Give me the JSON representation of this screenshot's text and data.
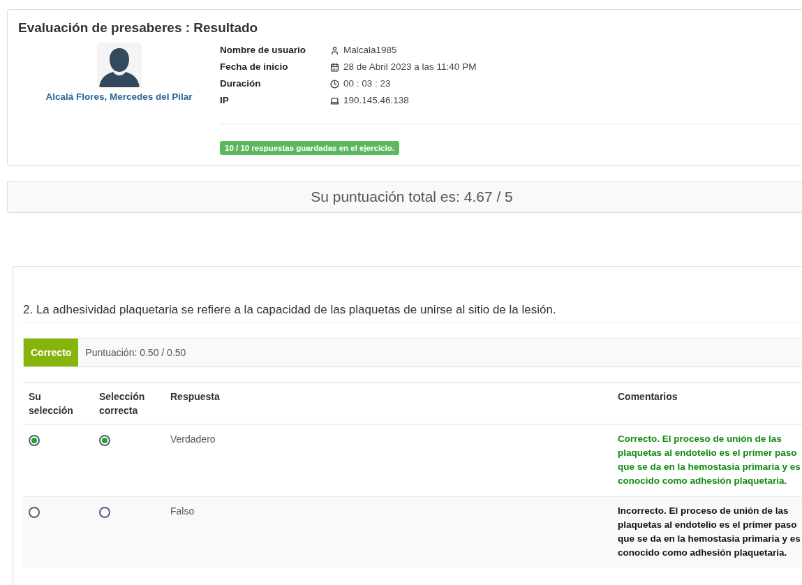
{
  "header": {
    "title": "Evaluación de presaberes : Resultado",
    "user_name": "Alcalá Flores, Mercedes del Pilar",
    "details": [
      {
        "label": "Nombre de usuario",
        "kind": "user",
        "value": "Malcala1985"
      },
      {
        "label": "Fecha de inicio",
        "kind": "calendar",
        "value": "28 de Abril 2023 a las 11:40 PM"
      },
      {
        "label": "Duración",
        "kind": "clock",
        "value": "00 : 03 : 23"
      },
      {
        "label": "IP",
        "kind": "computer",
        "value": "190.145.46.138"
      }
    ],
    "badge": "10 / 10 respuestas guardadas en el ejercicio."
  },
  "score": "Su puntuación total es: 4.67 / 5",
  "question": {
    "text": "2. La adhesividad plaquetaria se refiere a la capacidad de las plaquetas de unirse al sitio de la lesión.",
    "status": "Correcto",
    "status_correct": true,
    "points": "Puntuación: 0.50 / 0.50",
    "columns": [
      "Su selección",
      "Selección correcta",
      "Respuesta",
      "Comentarios"
    ],
    "rows": [
      {
        "your_selection": true,
        "correct_selection": true,
        "answer": "Verdadero",
        "comment": "Correcto. El proceso de unión de las plaquetas al endotelio es el primer paso que se da en la hemostasia primaria y es conocido como adhesión plaquetaria.",
        "comment_correct": true
      },
      {
        "your_selection": false,
        "correct_selection": false,
        "answer": "Falso",
        "comment": "Incorrecto. El proceso de unión de las plaquetas al endotelio es el primer paso que se da en la hemostasia primaria y es conocido como adhesión plaquetaria.",
        "comment_correct": false
      }
    ]
  }
}
